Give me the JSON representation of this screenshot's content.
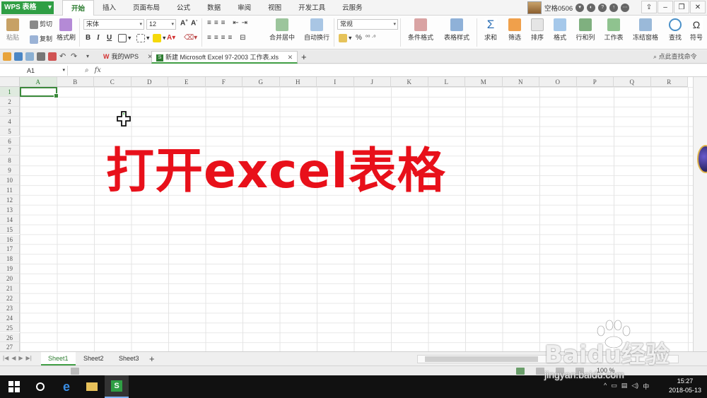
{
  "app": {
    "name": "WPS 表格"
  },
  "menu": {
    "tabs": [
      "开始",
      "插入",
      "页面布局",
      "公式",
      "数据",
      "审阅",
      "视图",
      "开发工具",
      "云服务"
    ],
    "active_index": 0
  },
  "user": {
    "name": "空格0506"
  },
  "ribbon": {
    "paste": "粘贴",
    "cut": "剪切",
    "copy": "复制",
    "format_painter": "格式刷",
    "font_name": "宋体",
    "font_size": "12",
    "bold": "B",
    "italic": "I",
    "underline": "U",
    "merge_center": "合并居中",
    "wrap_text": "自动换行",
    "number_format": "常规",
    "percent": "%",
    "cond_format": "条件格式",
    "table_style": "表格样式",
    "sum": "求和",
    "filter": "筛选",
    "sort": "排序",
    "format": "格式",
    "row_col": "行和列",
    "worksheet": "工作表",
    "freeze": "冻结窗格",
    "find": "查找",
    "symbol": "符号"
  },
  "doc_tabs": [
    {
      "label": "我的WPS"
    },
    {
      "label": "新建 Microsoft Excel 97-2003 工作表.xls"
    }
  ],
  "find_hint": "点此查找命令",
  "formula_bar": {
    "name_box": "A1",
    "fx": "fx"
  },
  "grid": {
    "columns": [
      "A",
      "B",
      "C",
      "D",
      "E",
      "F",
      "G",
      "H",
      "I",
      "J",
      "K",
      "L",
      "M",
      "N",
      "O",
      "P",
      "Q",
      "R"
    ],
    "rows": [
      "1",
      "2",
      "3",
      "4",
      "5",
      "6",
      "7",
      "8",
      "9",
      "10",
      "11",
      "12",
      "13",
      "14",
      "15",
      "16",
      "17",
      "18",
      "19",
      "20",
      "21",
      "22",
      "23",
      "24",
      "25",
      "26",
      "27"
    ]
  },
  "overlay_text": "打开excel表格",
  "sheets": [
    "Sheet1",
    "Sheet2",
    "Sheet3"
  ],
  "active_sheet": 0,
  "status": {
    "zoom": "100 %"
  },
  "taskbar": {
    "time": "15:27",
    "date": "2018-05-13",
    "ime": "中"
  },
  "watermark": {
    "logo": "Baidu经验",
    "url": "jingyan.baidu.com"
  },
  "colors": {
    "accent": "#2e7d32",
    "overlay": "#e8101a",
    "app_button": "#2f9e44"
  }
}
